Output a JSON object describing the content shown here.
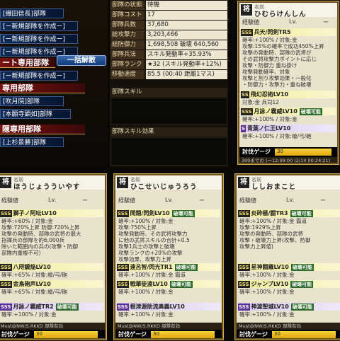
{
  "nav": {
    "items": [
      {
        "label": "[織田信長]部隊",
        "style": "blue"
      },
      {
        "label": "[ー新規部隊を作成ー]",
        "style": "blue"
      },
      {
        "label": "[ー新規部隊を作成ー]",
        "style": "blue"
      },
      {
        "label": "[ー新規部隊を作成ー]",
        "style": "blue"
      },
      {
        "label": "[ー新規部隊を作成ー]",
        "style": "blue"
      }
    ],
    "bulk_button": "一括解散",
    "section1_title": "ート専用部隊",
    "section2_title": "専用部隊",
    "sub1": [
      {
        "label": "[吹月院]部隊"
      },
      {
        "label": "[本願寺顕如]部隊"
      }
    ],
    "section3_title": "隠専用部隊",
    "sub2": [
      {
        "label": "[上杉景勝]部隊"
      }
    ]
  },
  "stats": {
    "rows": [
      {
        "label": "部隊の状態",
        "value": "待機"
      },
      {
        "label": "部隊コスト",
        "value": "17"
      },
      {
        "label": "部隊兵数",
        "value": "37,680"
      },
      {
        "label": "総攻撃力",
        "value": "3,203,466"
      },
      {
        "label": "総防御力",
        "value": "1,698,508  破壊  640,560"
      },
      {
        "label": "部隊兵法",
        "value": "スキル発動率+35.93%"
      },
      {
        "label": "部隊ランク",
        "value": "★32 (スキル発動率+12%)"
      },
      {
        "label": "移動速度",
        "value": "85.5 (00:40 距離1マス)"
      }
    ],
    "skill_header": "部隊スキル",
    "effect_header": "部隊スキル効果"
  },
  "cards": [
    {
      "name_label": "名前",
      "name": "ひむらけんしん",
      "lv_label": "経験値",
      "lv": "Lv.",
      "lvn": "ー",
      "skills": [
        {
          "grade": "SSS",
          "title": "兵天/閃剣TR5",
          "tag": "",
          "purple": false,
          "text": "確率:+100% / 対象:金\n攻撃:15%の確率で成功450%上昇\n攻撃の発動時、部隊の武将が\nその武将攻撃力ポイントに応じ\n攻撃・防御力 重ね掛け\n攻撃発動確率、対象\n攻撃と割り攻撃効果・一般化\n・防御力・攻撃力・重ね破壊"
        },
        {
          "grade": "SS",
          "title": "飛幻忍術LV10",
          "tag": "",
          "purple": false,
          "text": "対象:金 兵司12"
        },
        {
          "grade": "SSS",
          "title": "月詠ノ霸威LV10",
          "tag": "破壊可能",
          "purple": false,
          "text": "確率:+100% / 対象:金\n"
        },
        {
          "grade": "S",
          "title": "青葉ノ仁王LV10",
          "tag": "",
          "purple": true,
          "text": "確率:+100% / 対象:槍/弓/砲"
        }
      ],
      "cost_label": "討伐ゲージ",
      "cost_value": "30",
      "footer": "300までの (ー12:09:00 (2/14 00:24:21)"
    },
    {
      "name_label": "名前",
      "name": "ほうじょうういやす",
      "lv_label": "経験値",
      "lv": "Lv.",
      "lvn": "ー",
      "skills": [
        {
          "grade": "SSS",
          "title": "獅子ノ阿呍LV10",
          "tag": "",
          "purple": false,
          "text": "確率:+60% / 対象:金\n攻撃:720%上昇 防御:720%上昇\n攻撃の発動時、部隊の武将の最大\n指揮兵の部隊を約6,000兵\n除いた範囲内の兵の(攻撃・防御\n部隊内重複不可)"
        },
        {
          "grade": "SSS",
          "title": "八咫鏡焔LV10",
          "tag": "",
          "purple": false,
          "text": "確率:+65% / 対象:槍/弓/砲\n"
        },
        {
          "grade": "SSS",
          "title": "金鳥砲声LV10",
          "tag": "",
          "purple": false,
          "text": "確率:+65% / 対象:槍/弓/砲"
        },
        {
          "grade": "SSS",
          "title": "月詠ノ霸威TR2",
          "tag": "破壊可能",
          "purple": true,
          "text": "確率:+100% / 対象:金"
        }
      ],
      "cost_label": "討伐ゲージ",
      "cost_value": "30",
      "footer": "Must@NW/S.RKKD 部隊有効"
    },
    {
      "name_label": "名前",
      "name": "ひこせいじゅうろう",
      "lv_label": "経験値",
      "lv": "Lv.",
      "lvn": "ー",
      "skills": [
        {
          "grade": "SSS",
          "title": "問題/閃剣LV10",
          "tag": "破壊可能",
          "purple": false,
          "text": "確率:+100% / 対象:金\n攻撃:750%上昇\n攻撃発動時、その武将攻撃力\nに他の武将スキルの合計+0.5\n攻撃1兵士の攻撃と破壊\n攻撃ランクの+20%の攻撃\n攻撃効果、攻撃力上昇\n部隊内重複不可"
        },
        {
          "grade": "SSS",
          "title": "遠呂智/閃光TR1",
          "tag": "破壊可能",
          "purple": false,
          "text": "確率:+100% / 対象:金 霸道"
        },
        {
          "grade": "SSS",
          "title": "戦華徒渡LV10",
          "tag": "破壊可能",
          "purple": false,
          "text": "確率:+100% / 対象:金"
        },
        {
          "grade": "SSS",
          "title": "根津源助流奥義LV10",
          "tag": "",
          "purple": true,
          "text": "確率:+100% / 対象:金"
        }
      ],
      "cost_label": "討伐ゲージ",
      "cost_value": "30",
      "footer": "Must@NW/S.RKKD 部隊有効"
    },
    {
      "name_label": "名前",
      "name": "ししおまこと",
      "lv_label": "経験値",
      "lv": "Lv.",
      "lvn": "ー",
      "skills": [
        {
          "grade": "SSS",
          "title": "炎砕極/闘TR3",
          "tag": "破壊可能",
          "purple": false,
          "text": "確率:+100% / 対象:金 霸道\n攻撃:1929%上昇\n攻撃の発動時、部隊の武将\n攻撃・破壊力上昇(攻撃、防御\n攻撃力上昇値)"
        },
        {
          "grade": "SSS",
          "title": "星神闘羅LV10",
          "tag": "破壊可能",
          "purple": false,
          "text": "確率:+100% / 対象:金"
        },
        {
          "grade": "SSS",
          "title": "ジャンプLV10",
          "tag": "破壊可能",
          "purple": false,
          "text": "確率:+100% / 対象:金"
        },
        {
          "grade": "SSS",
          "title": "神渡聖城LV10",
          "tag": "破壊可能",
          "purple": true,
          "text": "確率:+100% / 対象:金"
        }
      ],
      "cost_label": "討伐ゲージ",
      "cost_value": "30",
      "footer": "Must@NW/S.RKKD 部隊有効"
    }
  ],
  "colors": {
    "accent": "#c7a84a",
    "frame": "#6b5420",
    "panel": "#e9e2cc"
  }
}
